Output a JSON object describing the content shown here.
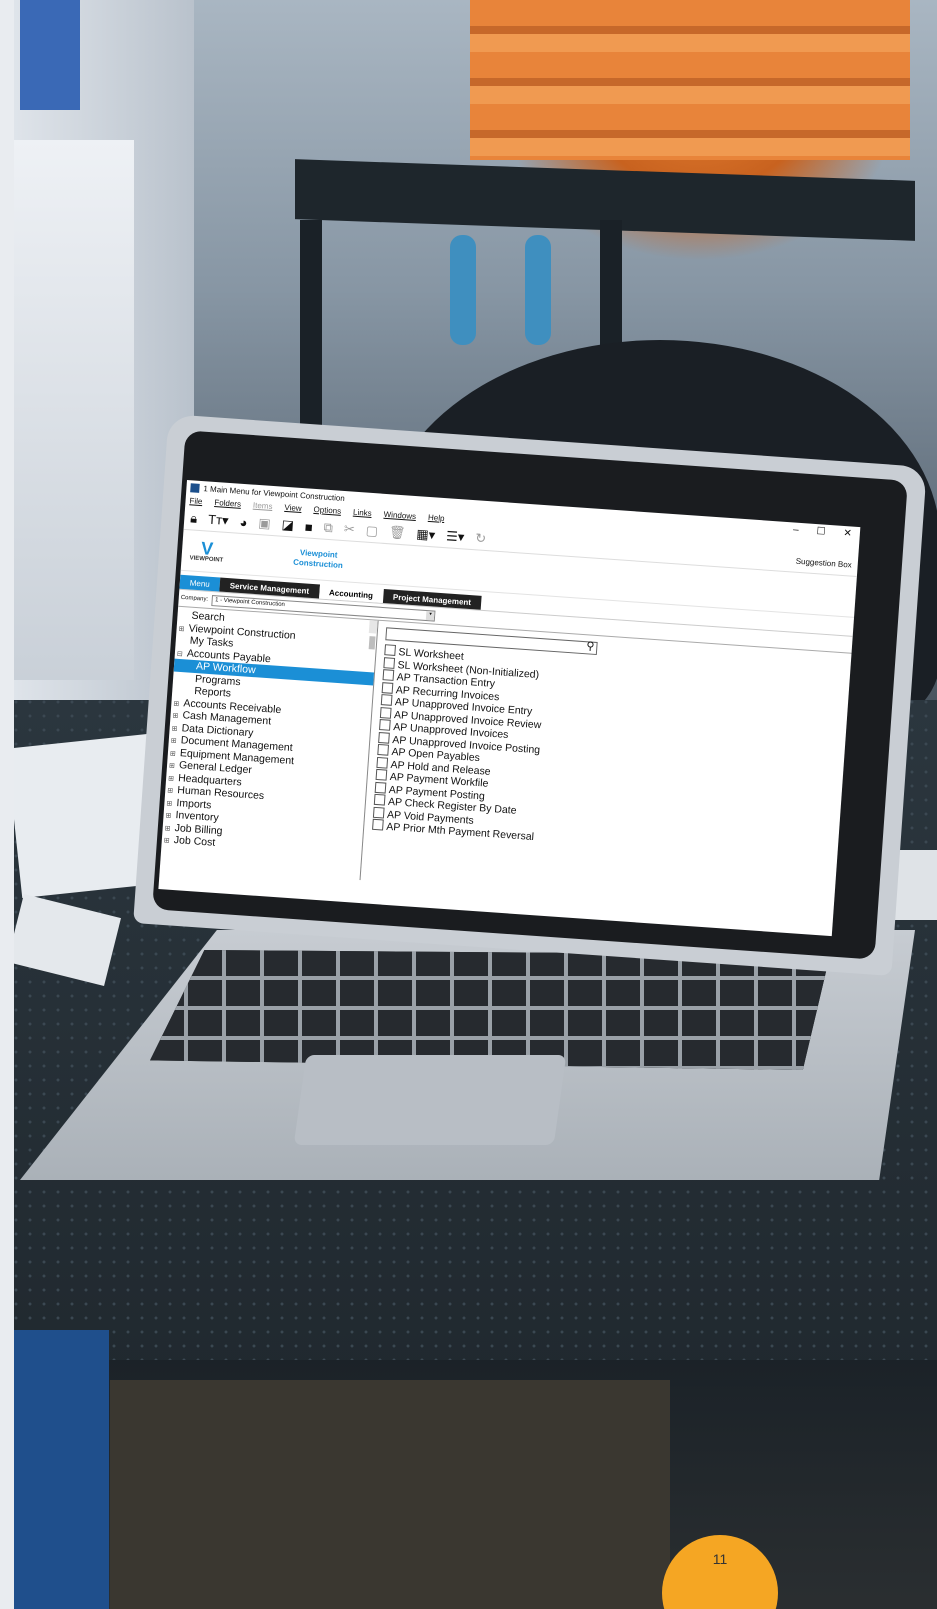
{
  "window": {
    "title": "1 Main Menu for Viewpoint Construction",
    "controls": [
      "–",
      "☐",
      "✕"
    ]
  },
  "menubar": [
    "File",
    "Folders",
    "Items",
    "View",
    "Options",
    "Links",
    "Windows",
    "Help"
  ],
  "toolbar": {
    "suggestion_box": "Suggestion Box"
  },
  "logo": {
    "mark": "V",
    "word": "VIEWPOINT",
    "company_line1": "Viewpoint",
    "company_line2": "Construction"
  },
  "tabs": [
    "Menu",
    "Service Management",
    "Accounting",
    "Project Management"
  ],
  "company": {
    "label": "Company:",
    "value": "1 - Viewpoint Construction"
  },
  "tree": [
    {
      "label": "Search",
      "exp": ""
    },
    {
      "label": "Viewpoint Construction",
      "exp": "⊞"
    },
    {
      "label": "My Tasks",
      "exp": ""
    },
    {
      "label": "Accounts Payable",
      "exp": "⊟"
    },
    {
      "label": "AP Workflow",
      "exp": "",
      "selected": true
    },
    {
      "label": "Programs",
      "exp": ""
    },
    {
      "label": "Reports",
      "exp": ""
    },
    {
      "label": "Accounts Receivable",
      "exp": "⊞"
    },
    {
      "label": "Cash Management",
      "exp": "⊞"
    },
    {
      "label": "Data Dictionary",
      "exp": "⊞"
    },
    {
      "label": "Document Management",
      "exp": "⊞"
    },
    {
      "label": "Equipment Management",
      "exp": "⊞"
    },
    {
      "label": "General Ledger",
      "exp": "⊞"
    },
    {
      "label": "Headquarters",
      "exp": "⊞"
    },
    {
      "label": "Human Resources",
      "exp": "⊞"
    },
    {
      "label": "Imports",
      "exp": "⊞"
    },
    {
      "label": "Inventory",
      "exp": "⊞"
    },
    {
      "label": "Job Billing",
      "exp": "⊞"
    },
    {
      "label": "Job Cost",
      "exp": "⊞"
    }
  ],
  "programs": [
    "SL Worksheet",
    "SL Worksheet (Non-Initialized)",
    "AP Transaction Entry",
    "AP Recurring Invoices",
    "AP Unapproved Invoice Entry",
    "AP Unapproved Invoice Review",
    "AP Unapproved Invoices",
    "AP Unapproved Invoice Posting",
    "AP Open Payables",
    "AP Hold and Release",
    "AP Payment Workfile",
    "AP Payment Posting",
    "AP Check Register By Date",
    "AP Void Payments",
    "AP Prior Mth Payment Reversal"
  ],
  "page_number": "11",
  "colors": {
    "accent": "#1b8fd6",
    "badge": "#f5a623"
  }
}
